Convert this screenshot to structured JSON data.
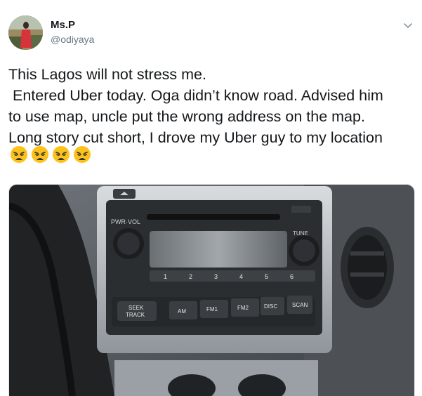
{
  "author": {
    "display_name": "Ms.P",
    "handle": "@odiyaya"
  },
  "tweet": {
    "text": "This Lagos will not stress me.\n Entered Uber today. Oga didn’t know road. Advised him\nto use map, uncle put the wrong address on the map.\nLong story cut short, I drove my Uber guy to my location",
    "emoji": [
      "weary-face",
      "weary-face",
      "weary-face",
      "weary-face"
    ]
  },
  "media": {
    "radio": {
      "pwr_vol": "PWR·VOL",
      "tune": "TUNE",
      "presets": [
        "1",
        "2",
        "3",
        "4",
        "5",
        "6"
      ],
      "buttons": [
        "AM",
        "FM1",
        "FM2",
        "DISC",
        "SCAN"
      ],
      "seek": "SEEK",
      "track": "TRACK"
    }
  },
  "colors": {
    "name": "#14171a",
    "handle": "#657786",
    "border": "#e1e8ed"
  }
}
